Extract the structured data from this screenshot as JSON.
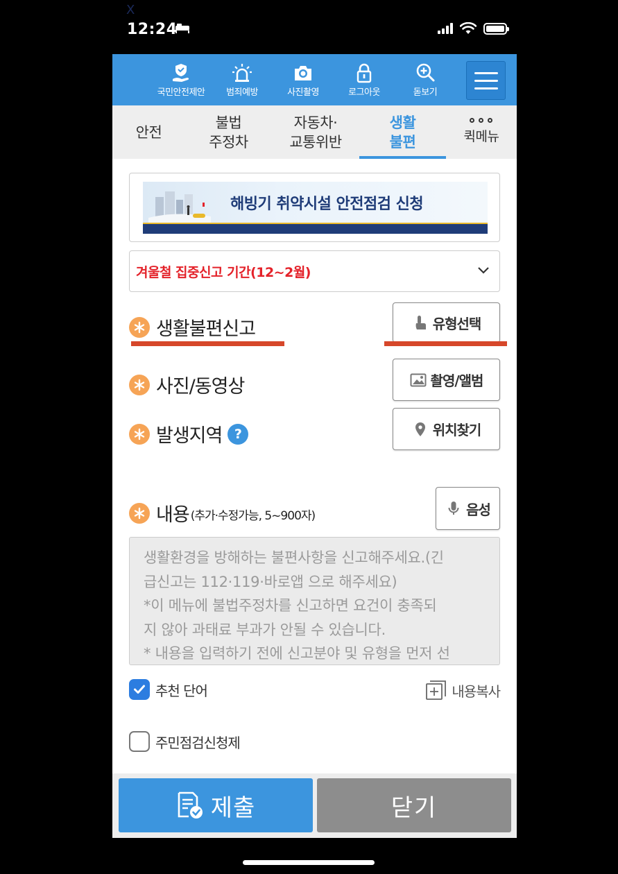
{
  "status_bar": {
    "time": "12:24",
    "corner_mark": "X"
  },
  "top_nav": [
    {
      "label": "국민안전제안",
      "icon": "hand-shield-icon"
    },
    {
      "label": "범죄예방",
      "icon": "siren-icon"
    },
    {
      "label": "사진촬영",
      "icon": "camera-icon"
    },
    {
      "label": "로그아웃",
      "icon": "lock-icon"
    },
    {
      "label": "돋보기",
      "icon": "magnifier-plus-icon"
    }
  ],
  "tabs": [
    {
      "label": "안전"
    },
    {
      "label": "불법\n주정차"
    },
    {
      "label": "자동차·\n교통위반"
    },
    {
      "label": "생활\n불편",
      "active": true
    },
    {
      "label": "퀵메뉴"
    }
  ],
  "banner": {
    "text_pre": "해빙기 ",
    "text_bold": "취약시설",
    "text_post": " 안전점검 신청"
  },
  "period_select": {
    "value": "겨울철 집중신고 기간(12~2월)"
  },
  "form": {
    "report_type": {
      "label": "생활불편신고",
      "button": "유형선택"
    },
    "media": {
      "label": "사진/동영상",
      "button": "촬영/앨범"
    },
    "location": {
      "label": "발생지역",
      "help": "?",
      "button": "위치찾기"
    },
    "content": {
      "label": "내용",
      "sub": "(추가·수정가능, 5~900자)",
      "button": "음성"
    },
    "content_placeholder": "생활환경을 방해하는 불편사항을 신고해주세요.(긴\n급신고는 112·119·바로앱 으로 해주세요)\n*이 메뉴에 불법주정차를 신고하면 요건이 충족되\n지 않아 과태료 부과가 안될 수 있습니다.\n* 내용을 입력하기 전에 신고분야 및 유형을 먼저 선"
  },
  "options": {
    "recommend": {
      "label": "추천 단어",
      "checked": true
    },
    "copy": {
      "label": "내용복사"
    },
    "resident": {
      "label": "주민점검신청제",
      "checked": false
    }
  },
  "footer": {
    "submit": "제출",
    "close": "닫기"
  },
  "colors": {
    "primary": "#3c95de",
    "accent_red": "#e4222a",
    "required": "#f6a456",
    "underline": "#d6472a"
  }
}
